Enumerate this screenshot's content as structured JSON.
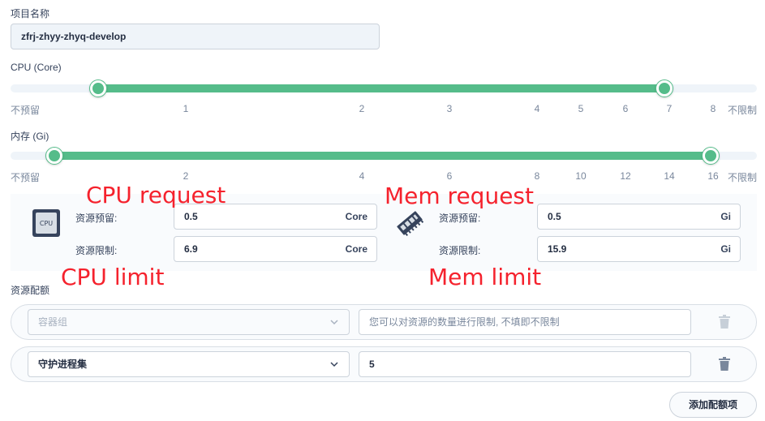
{
  "project": {
    "label": "项目名称",
    "value": "zfrj-zhyy-zhyq-develop"
  },
  "cpu_slider": {
    "label": "CPU (Core)",
    "ticks": [
      "不预留",
      "1",
      "2",
      "3",
      "4",
      "5",
      "6",
      "7",
      "8",
      "不限制"
    ],
    "request_value": 0.5,
    "limit_value": 6.9
  },
  "mem_slider": {
    "label": "内存 (Gi)",
    "ticks": [
      "不预留",
      "2",
      "4",
      "6",
      "8",
      "10",
      "12",
      "14",
      "16",
      "不限制"
    ],
    "request_value": 0.5,
    "limit_value": 15.9
  },
  "cpu": {
    "icon": "cpu-icon",
    "icon_text": "CPU",
    "request_label": "资源预留:",
    "request_value": "0.5",
    "request_unit": "Core",
    "limit_label": "资源限制:",
    "limit_value": "6.9",
    "limit_unit": "Core"
  },
  "memory": {
    "icon": "memory-icon",
    "request_label": "资源预留:",
    "request_value": "0.5",
    "request_unit": "Gi",
    "limit_label": "资源限制:",
    "limit_value": "15.9",
    "limit_unit": "Gi"
  },
  "annotations": {
    "cpu_request": "CPU request",
    "mem_request": "Mem request",
    "cpu_limit": "CPU limit",
    "mem_limit": "Mem limit"
  },
  "quota": {
    "label": "资源配额",
    "rows": [
      {
        "select": "容器组",
        "input_placeholder": "您可以对资源的数量进行限制, 不填即不限制",
        "input_value": ""
      },
      {
        "select": "守护进程集",
        "input_placeholder": "",
        "input_value": "5"
      }
    ],
    "add_button": "添加配额项"
  },
  "colors": {
    "accent": "#55bc8a",
    "annotation": "#f5222d",
    "text": "#36435c"
  }
}
